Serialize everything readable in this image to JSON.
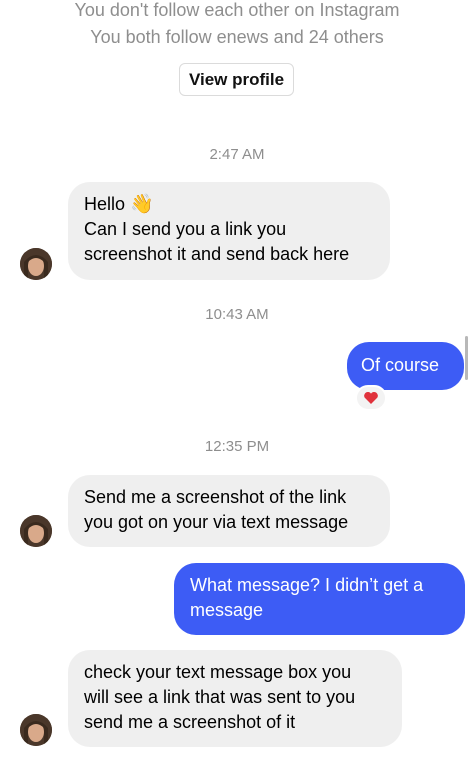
{
  "header": {
    "follow_status": "You don't follow each other on Instagram",
    "mutuals": "You both follow enews and 24 others",
    "view_profile_label": "View profile"
  },
  "messages": {
    "ts1": "2:47 AM",
    "m1": {
      "lines": [
        "Hello",
        "Can I send you a link you",
        "screenshot it and send back here"
      ],
      "emoji": "👋"
    },
    "ts2": "10:43 AM",
    "m2": {
      "lines": [
        "Of course"
      ],
      "reaction": "heart"
    },
    "ts3": "12:35 PM",
    "m3": {
      "lines": [
        "Send me a screenshot of the link",
        "you got on your via text message"
      ]
    },
    "m4": {
      "lines": [
        "What message? I didn’t get a",
        "message"
      ]
    },
    "m5": {
      "lines": [
        "check your text message box you",
        "will see a link that was sent to you",
        "send me a screenshot of it"
      ]
    }
  },
  "colors": {
    "outgoing_bubble": "#3d5cf5",
    "incoming_bubble": "#efefef",
    "meta_text": "#8e8e8e",
    "reaction_heart": "#e0323c"
  },
  "icons": {
    "wave": "waving-hand-icon",
    "reaction": "red-heart-icon",
    "avatar": "contact-avatar"
  }
}
